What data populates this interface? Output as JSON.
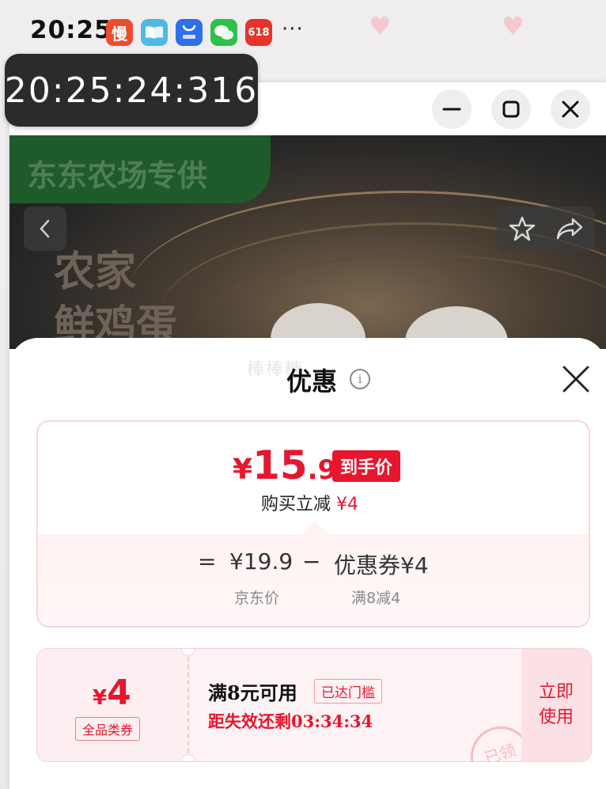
{
  "status_bar": {
    "time": "20:25",
    "more": "···",
    "apps": [
      {
        "icon": "manmanbuy-icon",
        "label": "慢",
        "color": "#ef4c2c"
      },
      {
        "icon": "reader-book-icon",
        "label": "",
        "color": "#4fb8e6"
      },
      {
        "icon": "app-market-icon",
        "label": "",
        "color": "#2f6fe8"
      },
      {
        "icon": "wechat-icon",
        "label": "",
        "color": "#2dc14a"
      },
      {
        "icon": "jd-618-icon",
        "label": "618",
        "color": "#e8332a"
      }
    ]
  },
  "timer": {
    "text": "20:25:24:316"
  },
  "hero": {
    "badge": "东东农场专供",
    "title_line1": "农家",
    "title_line2": "鲜鸡蛋"
  },
  "sheet": {
    "ghost_text": "棒棒糖",
    "title": "优惠",
    "price": {
      "currency": "¥",
      "integer": "15",
      "decimal": ".9",
      "tag": "到手价",
      "save_label": "购买立减",
      "save_amount": "¥4"
    },
    "formula": {
      "equals": "=",
      "jd_price": "¥19.9",
      "minus": "−",
      "coupon_label": "优惠券¥4",
      "jd_price_label": "京东价",
      "coupon_rule": "满8减4"
    },
    "coupon": {
      "currency": "¥",
      "amount": "4",
      "type": "全品类券",
      "condition": "满8元可用",
      "reached": "已达门槛",
      "expiry": "距失效还剩03:34:34",
      "use_button": "立即使用",
      "claimed": "已领"
    }
  },
  "colors": {
    "accent_red": "#e6162e",
    "timer_bg": "#2b2b2b"
  }
}
